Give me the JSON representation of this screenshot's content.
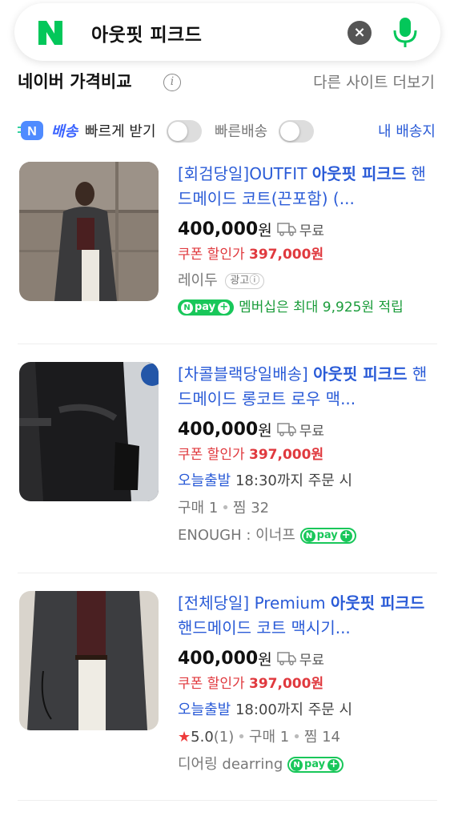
{
  "search": {
    "logo": "N",
    "query": "아웃핏 피크드",
    "clear_icon": "×"
  },
  "section": {
    "title": "네이버 가격비교",
    "more_sites": "다른 사이트 더보기"
  },
  "filters": {
    "delivery_badge": "N",
    "delivery_brand": "배송",
    "fast_receive_label": "빠르게 받기",
    "fast_delivery_label": "빠른배송",
    "my_delivery_label": "내 배송지"
  },
  "products": [
    {
      "title_prefix": "[회검당일]OUTFIT ",
      "title_highlight": "아웃핏 피크드",
      "title_suffix": " 핸드메이드 코트(끈포함) (...",
      "price": "400,000",
      "won": "원",
      "shipping": "무료",
      "coupon_label": "쿠폰 할인가",
      "coupon_price": "397,000원",
      "seller": "레이두",
      "ad_label": "광고",
      "npay_text": "pay",
      "membership": "멤버십은 최대 9,925원 적립"
    },
    {
      "title_prefix": "[차콜블랙당일배송] ",
      "title_highlight": "아웃핏 피크드",
      "title_suffix": " 핸드메이드 롱코트 로우 맥...",
      "price": "400,000",
      "won": "원",
      "shipping": "무료",
      "coupon_label": "쿠폰 할인가",
      "coupon_price": "397,000원",
      "today_ship": "오늘출발",
      "cutoff": "18:30까지 주문 시",
      "purchases": "구매 1",
      "wishes": "찜 32",
      "seller": "ENOUGH : 이너프",
      "npay_text": "pay"
    },
    {
      "title_prefix": "[전체당일] Premium ",
      "title_highlight": "아웃핏 피크드",
      "title_suffix": " 핸드메이드 코트 맥시기...",
      "price": "400,000",
      "won": "원",
      "shipping": "무료",
      "coupon_label": "쿠폰 할인가",
      "coupon_price": "397,000원",
      "today_ship": "오늘출발",
      "cutoff": "18:00까지 주문 시",
      "rating": "5.0",
      "rating_count": "(1)",
      "purchases": "구매 1",
      "wishes": "찜 14",
      "seller": "디어링 dearring",
      "npay_text": "pay"
    }
  ],
  "colors": {
    "brand_green": "#03c75a",
    "link_blue": "#2a5bd7",
    "coupon_red": "#e0393e",
    "npay_green": "#19c75a"
  }
}
